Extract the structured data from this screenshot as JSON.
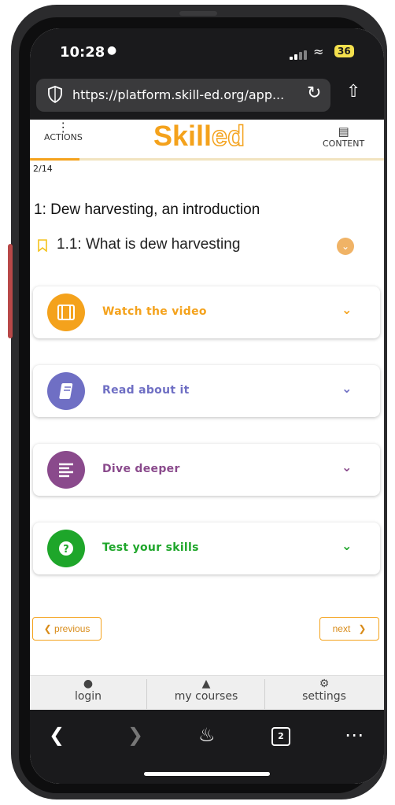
{
  "status": {
    "time": "10:28",
    "battery": "36"
  },
  "browser": {
    "url": "https://platform.skill-ed.org/app...",
    "tabs_count": "2"
  },
  "header": {
    "actions_label": "ACTIONS",
    "logo_part1": "Skill",
    "logo_part2": "ed",
    "content_label": "CONTENT",
    "page_counter": "2/14",
    "progress": 0.14
  },
  "module": {
    "title": "1: Dew harvesting, an introduction"
  },
  "lesson": {
    "title": "1.1: What is dew harvesting"
  },
  "cards": [
    {
      "label": "Watch the video",
      "color": "#f4a21c",
      "icon": "film-icon"
    },
    {
      "label": "Read about it",
      "color": "#6f6fc4",
      "icon": "book-icon"
    },
    {
      "label": "Dive deeper",
      "color": "#8a4a8c",
      "icon": "text-lines-icon"
    },
    {
      "label": "Test your skills",
      "color": "#1ea62a",
      "icon": "question-icon"
    }
  ],
  "pager": {
    "previous": "previous",
    "next": "next"
  },
  "bottom_nav": [
    {
      "label": "login",
      "icon": "user-icon"
    },
    {
      "label": "my courses",
      "icon": "graduation-cap-icon"
    },
    {
      "label": "settings",
      "icon": "gear-icon"
    }
  ],
  "colors": {
    "accent": "#f4a21c"
  }
}
